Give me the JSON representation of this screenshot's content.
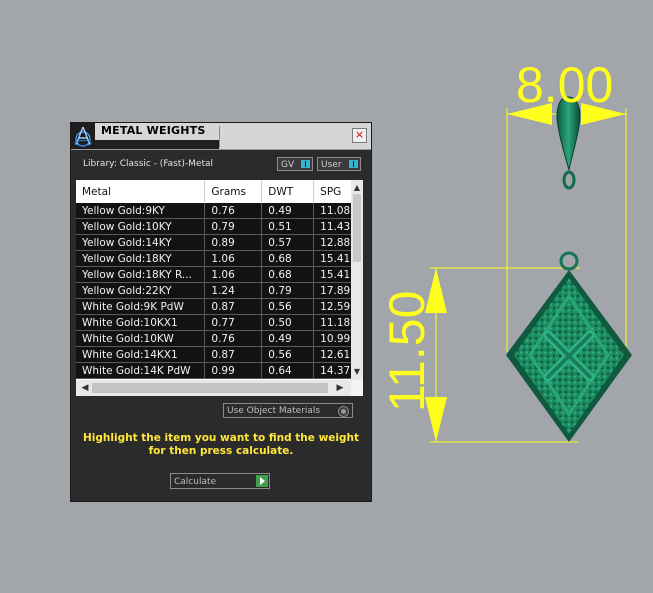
{
  "window": {
    "title": "METAL WEIGHTS",
    "close_label": "×"
  },
  "library_label": "Library: Classic - (Fast)-Metal",
  "toggles": {
    "gv": "GV",
    "user": "User"
  },
  "table": {
    "headers": [
      "Metal",
      "Grams",
      "DWT",
      "SPG"
    ],
    "rows": [
      [
        "Yellow Gold:9KY",
        "0.76",
        "0.49",
        "11.08"
      ],
      [
        "Yellow Gold:10KY",
        "0.79",
        "0.51",
        "11.43"
      ],
      [
        "Yellow Gold:14KY",
        "0.89",
        "0.57",
        "12.88"
      ],
      [
        "Yellow Gold:18KY",
        "1.06",
        "0.68",
        "15.41"
      ],
      [
        "Yellow Gold:18KY R...",
        "1.06",
        "0.68",
        "15.41"
      ],
      [
        "Yellow Gold:22KY",
        "1.24",
        "0.79",
        "17.89"
      ],
      [
        "White Gold:9K PdW",
        "0.87",
        "0.56",
        "12.59"
      ],
      [
        "White Gold:10KX1",
        "0.77",
        "0.50",
        "11.18"
      ],
      [
        "White Gold:10KW",
        "0.76",
        "0.49",
        "10.99"
      ],
      [
        "White Gold:14KX1",
        "0.87",
        "0.56",
        "12.61"
      ],
      [
        "White Gold:14K PdW",
        "0.99",
        "0.64",
        "14.37"
      ]
    ]
  },
  "use_object_materials": "Use Object Materials",
  "hint": "Highlight the item you want to find the weight for then press calculate.",
  "calculate_label": "Calculate",
  "dimensions": {
    "width": "8.00",
    "height": "11.50"
  },
  "colors": {
    "dimension": "#ffff1e",
    "model": "#1e9a6e",
    "accent": "#36b4cc",
    "hint": "#ffe83a"
  }
}
